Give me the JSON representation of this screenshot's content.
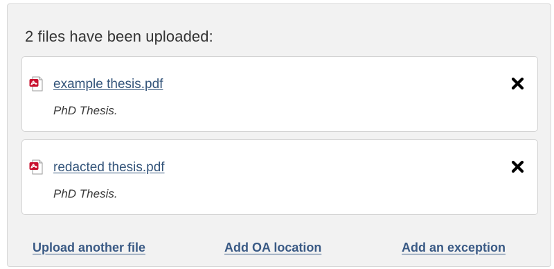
{
  "upload_panel": {
    "summary": "2 files have been uploaded:",
    "files": [
      {
        "name": "example thesis.pdf",
        "description": "PhD Thesis.",
        "icon": "pdf-file-icon",
        "remove_icon": "close-icon"
      },
      {
        "name": "redacted thesis.pdf",
        "description": "PhD Thesis.",
        "icon": "pdf-file-icon",
        "remove_icon": "close-icon"
      }
    ],
    "actions": {
      "upload_another": "Upload another file",
      "add_oa_location": "Add OA location",
      "add_exception": "Add an exception"
    }
  },
  "colors": {
    "panel_background": "#f2f2f2",
    "link": "#33547a",
    "pdf_icon_red": "#c8102e"
  }
}
